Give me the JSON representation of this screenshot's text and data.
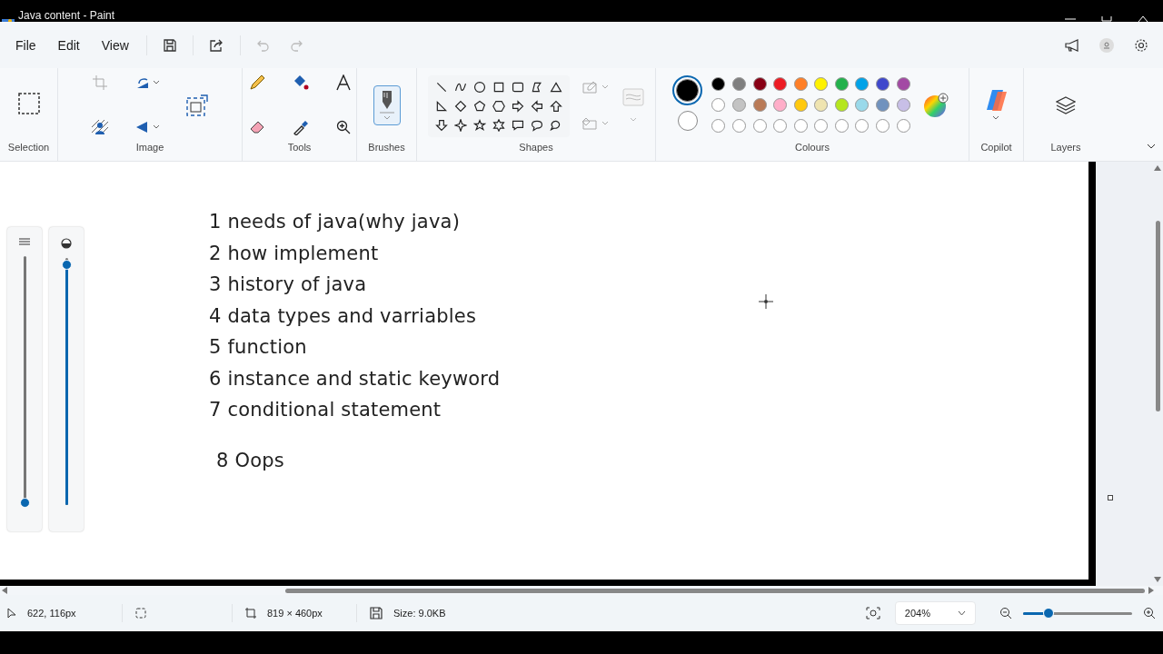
{
  "window": {
    "title": "Java content - Paint"
  },
  "menu": [
    {
      "label": "File"
    },
    {
      "label": "Edit"
    },
    {
      "label": "View"
    }
  ],
  "ribbon": {
    "groups": [
      {
        "label": "Selection"
      },
      {
        "label": "Image"
      },
      {
        "label": "Tools"
      },
      {
        "label": "Brushes"
      },
      {
        "label": "Shapes"
      },
      {
        "label": "Colours"
      },
      {
        "label": "Copilot"
      },
      {
        "label": "Layers"
      }
    ]
  },
  "colours": {
    "primary": {
      "color": "#000000",
      "selected": true
    },
    "secondary": {
      "color": "#ffffff",
      "selected": false
    },
    "swatches": [
      {
        "kind": "swatch",
        "color": "#000000"
      },
      {
        "kind": "swatch",
        "color": "#7f7f7f"
      },
      {
        "kind": "swatch",
        "color": "#880015"
      },
      {
        "kind": "swatch",
        "color": "#ed1c24"
      },
      {
        "kind": "swatch",
        "color": "#ff7f27"
      },
      {
        "kind": "swatch",
        "color": "#fff200"
      },
      {
        "kind": "swatch",
        "color": "#22b14c"
      },
      {
        "kind": "swatch",
        "color": "#00a2e8"
      },
      {
        "kind": "swatch",
        "color": "#3f48cc"
      },
      {
        "kind": "swatch",
        "color": "#a349a4"
      },
      {
        "kind": "swatch",
        "color": "#ffffff"
      },
      {
        "kind": "swatch",
        "color": "#c3c3c3"
      },
      {
        "kind": "swatch",
        "color": "#b97a57"
      },
      {
        "kind": "swatch",
        "color": "#ffaec9"
      },
      {
        "kind": "swatch",
        "color": "#ffc90e"
      },
      {
        "kind": "swatch",
        "color": "#efe4b0"
      },
      {
        "kind": "swatch",
        "color": "#b5e61d"
      },
      {
        "kind": "swatch",
        "color": "#99d9ea"
      },
      {
        "kind": "swatch",
        "color": "#7092be"
      },
      {
        "kind": "swatch",
        "color": "#c8bfe7"
      },
      {
        "kind": "empty"
      },
      {
        "kind": "empty"
      },
      {
        "kind": "empty"
      },
      {
        "kind": "empty"
      },
      {
        "kind": "empty"
      },
      {
        "kind": "empty"
      },
      {
        "kind": "empty"
      },
      {
        "kind": "empty"
      },
      {
        "kind": "empty"
      },
      {
        "kind": "empty"
      }
    ]
  },
  "side_panel": {
    "size_slider": {
      "level": 0
    },
    "opacity_slider": {
      "level": 0.97
    }
  },
  "canvas": {
    "lines": [
      {
        "text": "1 needs of java(why java)"
      },
      {
        "text": "2 how implement"
      },
      {
        "text": "3 history of java"
      },
      {
        "text": "4 data types and varriables"
      },
      {
        "text": "5 function"
      },
      {
        "text": "6 instance and static keyword"
      },
      {
        "text": "7 conditional statement"
      },
      {
        "text": "8 Oops",
        "kind": "gap"
      }
    ]
  },
  "status_bar": {
    "cursor": "622, 116px",
    "canvas_size": "819 × 460px",
    "file_size": "Size: 9.0KB",
    "zoom": "204%",
    "zoom_slider": {
      "level": 0.23
    }
  }
}
